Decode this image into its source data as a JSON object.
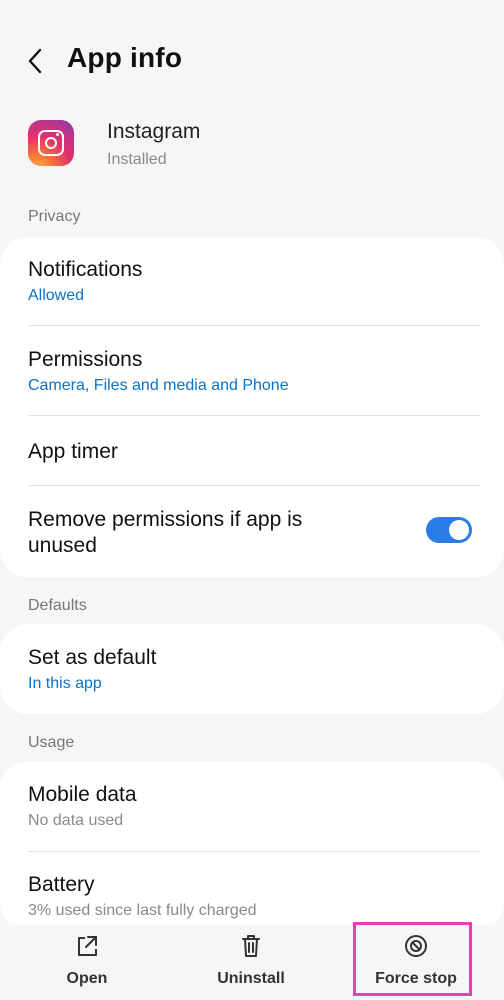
{
  "header": {
    "title": "App info"
  },
  "app": {
    "name": "Instagram",
    "status": "Installed"
  },
  "sections": {
    "privacy": "Privacy",
    "defaults": "Defaults",
    "usage": "Usage"
  },
  "privacy_items": {
    "notifications": {
      "title": "Notifications",
      "sub": "Allowed"
    },
    "permissions": {
      "title": "Permissions",
      "sub": "Camera, Files and media and Phone"
    },
    "app_timer": {
      "title": "App timer"
    },
    "remove_permissions": {
      "title_line1": "Remove permissions if app is",
      "title_line2": "unused",
      "toggle_on": true
    }
  },
  "defaults_items": {
    "set_as_default": {
      "title": "Set as default",
      "sub": "In this app"
    }
  },
  "usage_items": {
    "mobile_data": {
      "title": "Mobile data",
      "sub": "No data used"
    },
    "battery": {
      "title": "Battery",
      "sub": "3% used since last fully charged"
    }
  },
  "bottom_bar": {
    "open": "Open",
    "uninstall": "Uninstall",
    "force_stop": "Force stop"
  },
  "colors": {
    "accent": "#0a73c8",
    "toggle": "#2b7ce6",
    "highlight": "#e83fb8",
    "background": "#f6f6f6"
  },
  "icons": {
    "back": "chevron-left-icon",
    "open": "open-external-icon",
    "uninstall": "trash-icon",
    "force_stop": "block-icon"
  }
}
